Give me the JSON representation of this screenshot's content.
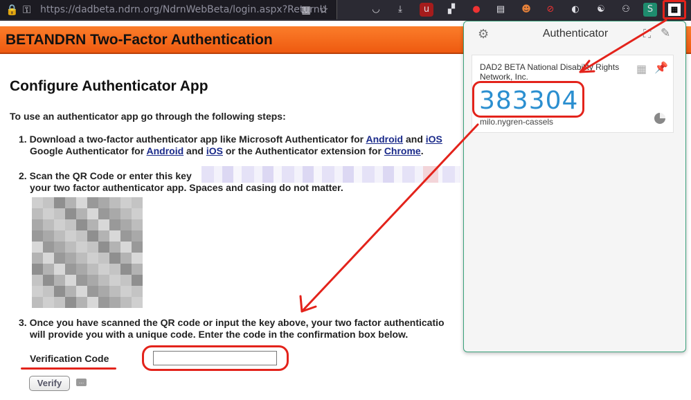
{
  "browser": {
    "url": "https://dadbeta.ndrn.org/NdrnWebBeta/login.aspx?ReturnU",
    "extension_icons": [
      "pocket-icon",
      "download-icon",
      "ublock-icon",
      "extensions-grid-icon",
      "red-ext-icon",
      "container-icon",
      "chipmunk-icon",
      "blocker-icon",
      "privacy-icon",
      "yin-yang-icon",
      "owl-icon",
      "stylus-icon",
      "authenticator-qr-icon"
    ]
  },
  "page": {
    "header_title": "BETANDRN Two-Factor Authentication",
    "heading": "Configure Authenticator App",
    "intro": "To use an authenticator app go through the following steps:",
    "step1": {
      "pre": "1. Download a two-factor authenticator app like Microsoft Authenticator for ",
      "link_android_1": "Android",
      "mid1": " and ",
      "link_ios_1": "iOS",
      "line2_pre": "Google Authenticator for ",
      "link_android_2": "Android",
      "mid2": " and ",
      "link_ios_2": "iOS",
      "mid3": " or the Authenticator extension for ",
      "link_chrome": "Chrome",
      "end": "."
    },
    "step2": {
      "line1": "2. Scan the QR Code or enter this key",
      "line2": "your two factor authenticator app. Spaces and casing do not matter."
    },
    "step3": {
      "line1": "3. Once you have scanned the QR code or input the key above, your two factor authenticatio",
      "line2": "will provide you with a unique code. Enter the code in the confirmation box below."
    },
    "verification_label": "Verification Code",
    "verification_value": "",
    "verify_button": "Verify"
  },
  "authenticator": {
    "title": "Authenticator",
    "entry": {
      "issuer": "DAD2 BETA National Disability Rights Network, Inc.",
      "code": "383304",
      "account": "milo.nygren-cassels"
    }
  },
  "colors": {
    "header_orange": "#f26a1b",
    "annotation_red": "#e3231b",
    "otp_blue": "#2b8fd0",
    "link_blue": "#1a2a8a"
  }
}
